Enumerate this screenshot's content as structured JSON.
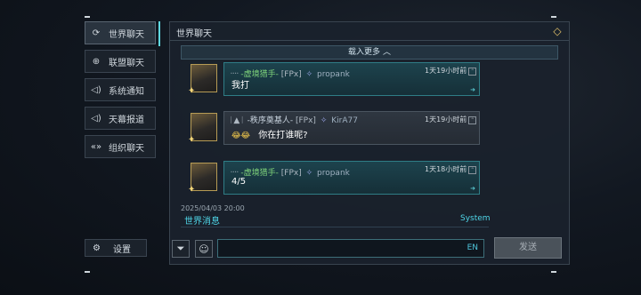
{
  "sidebar": {
    "items": [
      {
        "label": "世界聊天",
        "icon": "world-chat-icon"
      },
      {
        "label": "联盟聊天",
        "icon": "globe-icon"
      },
      {
        "label": "系统通知",
        "icon": "speaker-icon"
      },
      {
        "label": "天幕报道",
        "icon": "speaker-icon"
      },
      {
        "label": "组织聊天",
        "icon": "organization-icon"
      }
    ],
    "settings_label": "设置"
  },
  "panel": {
    "title": "世界聊天",
    "load_more": "载入更多"
  },
  "messages": [
    {
      "rank": "-虚境猎手-",
      "tag": "[FPx]",
      "server_name": "propank",
      "time": "1天19小时前",
      "text": "我打",
      "style": "teal"
    },
    {
      "rank": "-秩序奠基人-",
      "tag": "[FPx]",
      "server_name": "KirA77",
      "time": "1天19小时前",
      "text": "你在打谁呢?",
      "style": "grey"
    },
    {
      "rank": "-虚境猎手-",
      "tag": "[FPx]",
      "server_name": "propank",
      "time": "1天18小时前",
      "text": "4/5",
      "style": "teal"
    }
  ],
  "system": {
    "date": "2025/04/03 20:00",
    "label": "世界消息",
    "source": "System"
  },
  "input": {
    "lang": "EN",
    "send_label": "发送"
  },
  "colors": {
    "accent": "#4fd6e8",
    "rank_green": "#7fd37a",
    "gold": "#e3c26a"
  }
}
